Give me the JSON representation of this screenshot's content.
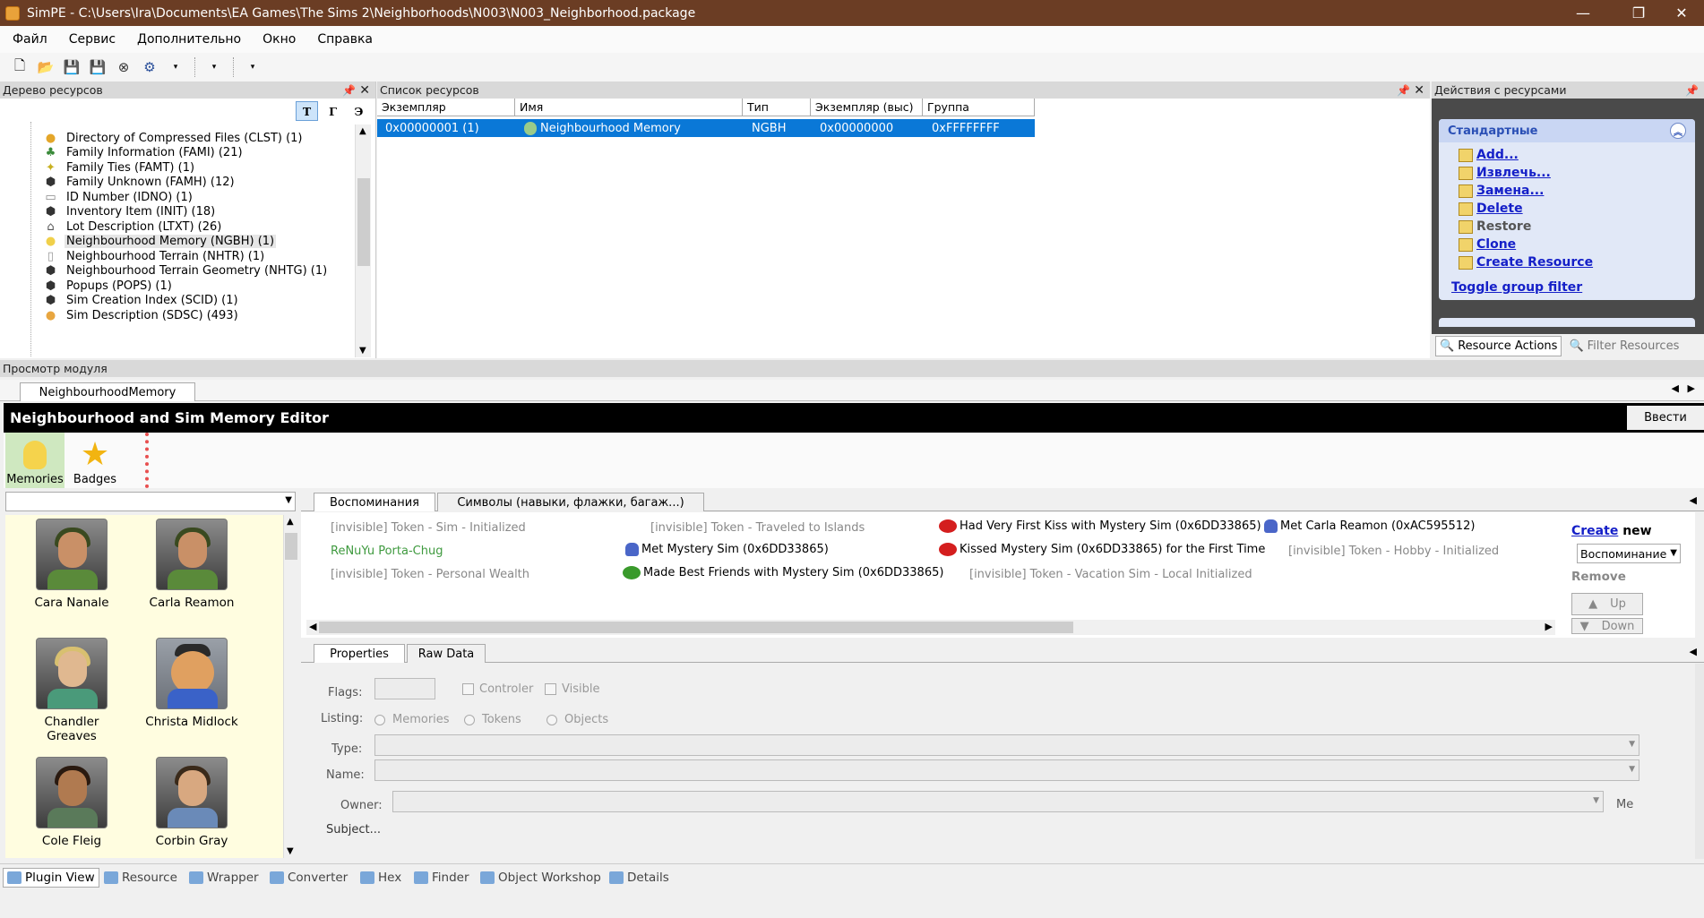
{
  "window": {
    "title": "SimPE - C:\\Users\\Ira\\Documents\\EA Games\\The Sims 2\\Neighborhoods\\N003\\N003_Neighborhood.package"
  },
  "menu": [
    "Файл",
    "Сервис",
    "Дополнительно",
    "Окно",
    "Справка"
  ],
  "tree": {
    "header": "Дерево ресурсов",
    "toggles": [
      "T",
      "Γ",
      "Э"
    ],
    "items": [
      {
        "label": "Directory of Compressed Files (CLST) (1)",
        "icon": "folder-icon"
      },
      {
        "label": "Family Information (FAMI) (21)",
        "icon": "family-icon"
      },
      {
        "label": "Family Ties (FAMT) (1)",
        "icon": "ties-icon"
      },
      {
        "label": "Family Unknown (FAMH) (12)",
        "icon": "cube-icon"
      },
      {
        "label": "ID Number (IDNO) (1)",
        "icon": "id-icon"
      },
      {
        "label": "Inventory Item (INIT) (18)",
        "icon": "cube-icon"
      },
      {
        "label": "Lot Description (LTXT) (26)",
        "icon": "house-icon"
      },
      {
        "label": "Neighbourhood Memory (NGBH) (1)",
        "icon": "bulb-icon"
      },
      {
        "label": "Neighbourhood Terrain (NHTR) (1)",
        "icon": "page-icon"
      },
      {
        "label": "Neighbourhood Terrain Geometry (NHTG) (1)",
        "icon": "cube-icon"
      },
      {
        "label": "Popups (POPS) (1)",
        "icon": "cube-icon"
      },
      {
        "label": "Sim Creation Index (SCID) (1)",
        "icon": "cube-icon"
      },
      {
        "label": "Sim Description (SDSC) (493)",
        "icon": "sim-icon"
      }
    ]
  },
  "list": {
    "header": "Список ресурсов",
    "columns": [
      "Экземпляр",
      "Имя",
      "Тип",
      "Экземпляр (выс)",
      "Группа"
    ],
    "row": [
      "0x00000001 (1)",
      "Neighbourhood Memory",
      "NGBH",
      "0x00000000",
      "0xFFFFFFFF"
    ]
  },
  "actions": {
    "header": "Действия с ресурсами",
    "group": "Стандартные",
    "links": [
      "Add...",
      "Извлечь...",
      "Замена...",
      "Delete",
      "Restore",
      "Clone",
      "Create Resource"
    ],
    "toggle": "Toggle group filter",
    "tabs": [
      "Resource Actions",
      "Filter Resources"
    ]
  },
  "plugin": {
    "header": "Просмотр модуля",
    "tab": "NeighbourhoodMemory",
    "banner": "Neighbourhood and Sim Memory Editor",
    "enter": "Ввести",
    "modes": [
      "Memories",
      "Badges"
    ]
  },
  "sims": [
    "Cara Nanale",
    "Carla Reamon",
    "Chandler Greaves",
    "Christa Midlock",
    "Cole Fleig",
    "Corbin Gray"
  ],
  "memtabs": [
    "Воспоминания",
    "Символы (навыки, флажки, багаж...)"
  ],
  "memories": [
    "[invisible] Token - Sim - Initialized",
    "ReNuYu Porta-Chug",
    "[invisible] Token - Personal Wealth",
    "[invisible] Token - Traveled to Islands",
    "Met Mystery Sim (0x6DD33865)",
    "Made Best Friends with Mystery Sim (0x6DD33865)",
    "Had Very First Kiss with Mystery Sim (0x6DD33865)",
    "Kissed Mystery Sim (0x6DD33865) for the First Time",
    "[invisible] Token - Vacation Sim - Local Initialized",
    "Met Carla Reamon (0xAC595512)",
    "[invisible] Token - Hobby - Initialized"
  ],
  "side": {
    "create": "Create",
    "new": "new",
    "type": "Воспоминание",
    "remove": "Remove",
    "up": "Up",
    "down": "Down"
  },
  "proptabs": [
    "Properties",
    "Raw Data"
  ],
  "props": {
    "flags": "Flags:",
    "controler": "Controler",
    "visible": "Visible",
    "listing": "Listing:",
    "memories": "Memories",
    "tokens": "Tokens",
    "objects": "Objects",
    "type": "Type:",
    "name": "Name:",
    "owner": "Owner:",
    "me": "Me",
    "subject": "Subject..."
  },
  "bottomtabs": [
    "Plugin View",
    "Resource",
    "Wrapper",
    "Converter",
    "Hex",
    "Finder",
    "Object Workshop",
    "Details"
  ],
  "colors": {
    "titlebar": "#6b3d24",
    "selection": "#0a78d7",
    "link": "#1520c8",
    "actions_bg": "#e1e8f7"
  }
}
